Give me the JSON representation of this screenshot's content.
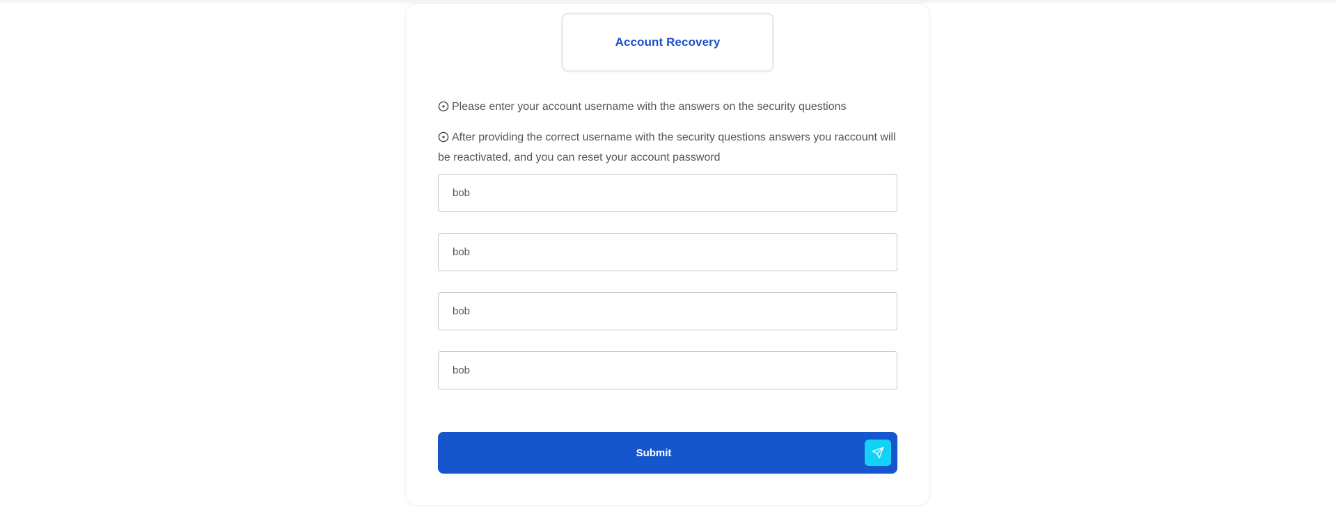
{
  "page": {
    "title": "Account Recovery"
  },
  "info": {
    "line1": "Please enter your account username with the answers on the security questions",
    "line2": "After providing the correct username with the security questions answers you raccount will be reactivated, and you can reset your account password",
    "icon": "circle-dot-icon"
  },
  "form": {
    "fields": [
      {
        "value": "bob"
      },
      {
        "value": "bob"
      },
      {
        "value": "bob"
      },
      {
        "value": "bob"
      }
    ],
    "submit_label": "Submit",
    "submit_icon": "send-icon"
  },
  "colors": {
    "title": "#1a4fc9",
    "submit_bg": "#1656cc",
    "submit_icon_bg": "#12d3f5",
    "text": "#555555"
  }
}
